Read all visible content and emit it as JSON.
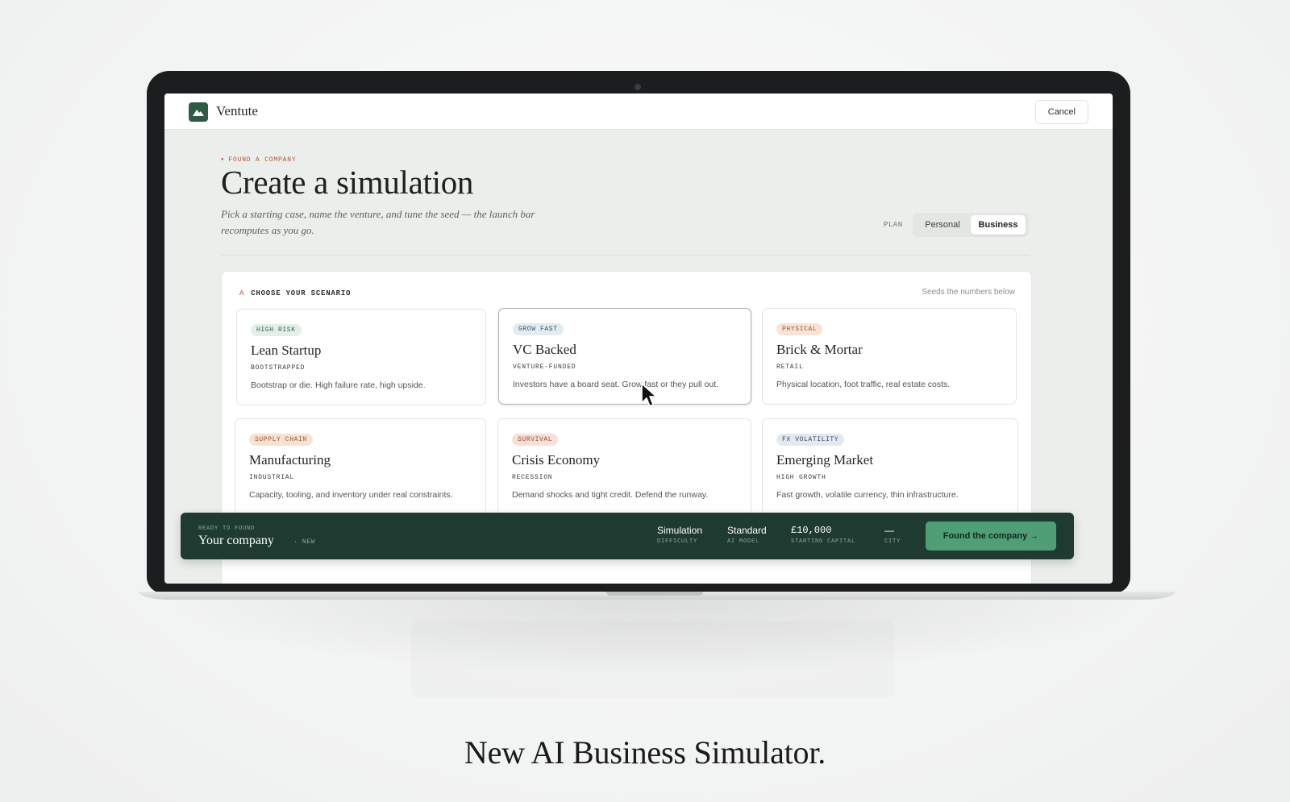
{
  "app": {
    "brand": "Ventute",
    "cancel_label": "Cancel"
  },
  "hero": {
    "eyebrow": "FOUND A COMPANY",
    "title": "Create a simulation",
    "subtitle": "Pick a starting case, name the venture, and tune the seed — the launch bar recomputes as you go."
  },
  "plan": {
    "label": "PLAN",
    "options": [
      "Personal",
      "Business"
    ],
    "selected": "Business"
  },
  "scenario": {
    "letter": "A",
    "label": "CHOOSE YOUR SCENARIO",
    "hint": "Seeds the numbers below",
    "cards": [
      {
        "tag": "HIGH RISK",
        "title": "Lean Startup",
        "sub": "BOOTSTRAPPED",
        "desc": "Bootstrap or die. High failure rate, high upside."
      },
      {
        "tag": "GROW FAST",
        "title": "VC Backed",
        "sub": "VENTURE-FUNDED",
        "desc": "Investors have a board seat. Grow fast or they pull out."
      },
      {
        "tag": "PHYSICAL",
        "title": "Brick & Mortar",
        "sub": "RETAIL",
        "desc": "Physical location, foot traffic, real estate costs."
      },
      {
        "tag": "SUPPLY CHAIN",
        "title": "Manufacturing",
        "sub": "INDUSTRIAL",
        "desc": "Capacity, tooling, and inventory under real constraints."
      },
      {
        "tag": "SURVIVAL",
        "title": "Crisis Economy",
        "sub": "RECESSION",
        "desc": "Demand shocks and tight credit. Defend the runway."
      },
      {
        "tag": "FX VOLATILITY",
        "title": "Emerging Market",
        "sub": "HIGH GROWTH",
        "desc": "Fast growth, volatile currency, thin infrastructure."
      }
    ],
    "selected_index": 1
  },
  "footbar": {
    "ready_label": "READY TO FOUND",
    "company_name": "Your company",
    "company_status": "NEW",
    "stats": [
      {
        "value": "Simulation",
        "label": "DIFFICULTY"
      },
      {
        "value": "Standard",
        "label": "AI MODEL"
      },
      {
        "value": "£10,000",
        "label": "STARTING CAPITAL"
      },
      {
        "value": "—",
        "label": "CITY"
      }
    ],
    "cta_label": "Found the company →"
  },
  "caption": "New AI Business Simulator.",
  "colors": {
    "brand_green": "#2f5a48",
    "footbar_bg": "#1f3a31",
    "cta_green": "#4f9e76",
    "accent_orange": "#b5532e",
    "tag_high_risk": "#e3efe7",
    "tag_grow_fast": "#e2ecf0",
    "tag_physical": "#f7e4d8",
    "tag_supply_chain": "#f7e2d6",
    "tag_survival": "#f7e0da",
    "tag_fx_volatility": "#e4e9ef"
  },
  "icons": [
    "mountain-logo-icon",
    "cursor-icon",
    "arrow-right-icon"
  ]
}
